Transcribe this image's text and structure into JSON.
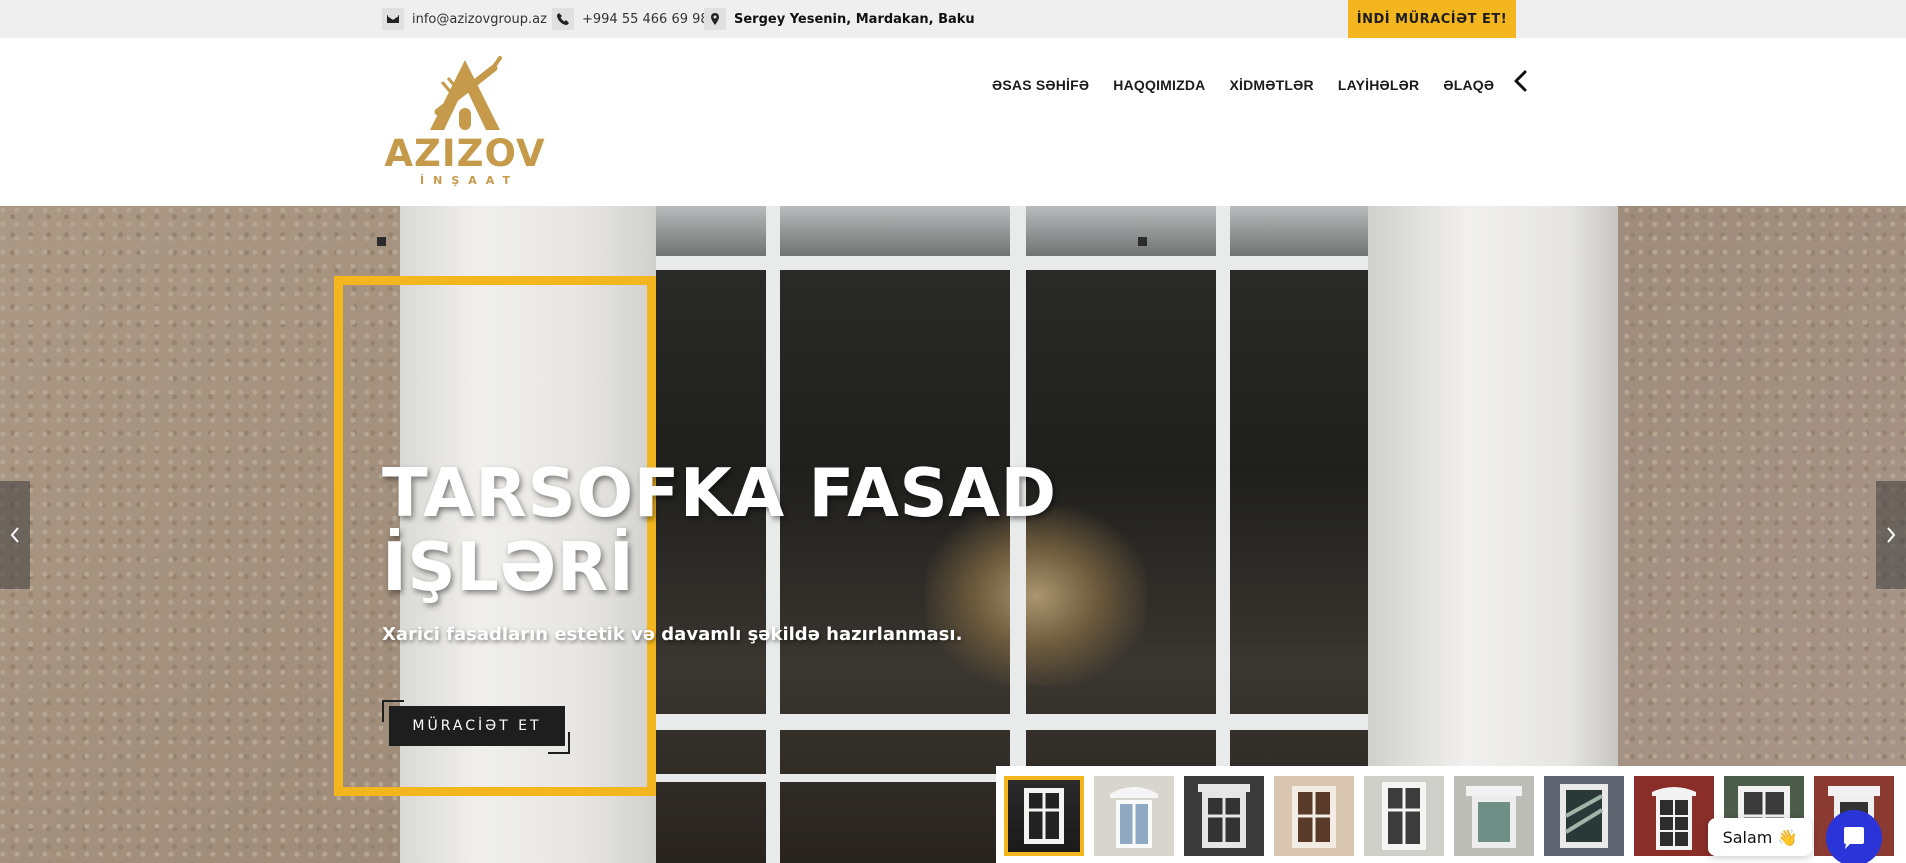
{
  "topbar": {
    "email": "info@azizovgroup.az",
    "phone": "+994 55 466 69 98",
    "address": "Sergey Yesenin, Mardakan, Baku",
    "cta_label": "İNDİ MÜRACİƏT ET!"
  },
  "logo": {
    "word": "AZIZOV",
    "sub": "İNŞAAT"
  },
  "nav": {
    "items": [
      "ƏSAS SƏHİFƏ",
      "HAQQIMIZDA",
      "XİDMƏTLƏR",
      "LAYİHƏLƏR",
      "ƏLAQƏ"
    ]
  },
  "hero": {
    "title_line1": "TARSOFKA FASAD",
    "title_line2": "İŞLƏRİ",
    "subtitle": "Xarici fasadların estetik və davamlı şəkildə hazırlanması.",
    "button_label": "MÜRACİƏT ET"
  },
  "chat": {
    "greeting": "Salam 👋"
  },
  "colors": {
    "accent": "#f4b61f",
    "logo_gold": "#c59a4b",
    "chat_blue": "#2b34d8"
  }
}
